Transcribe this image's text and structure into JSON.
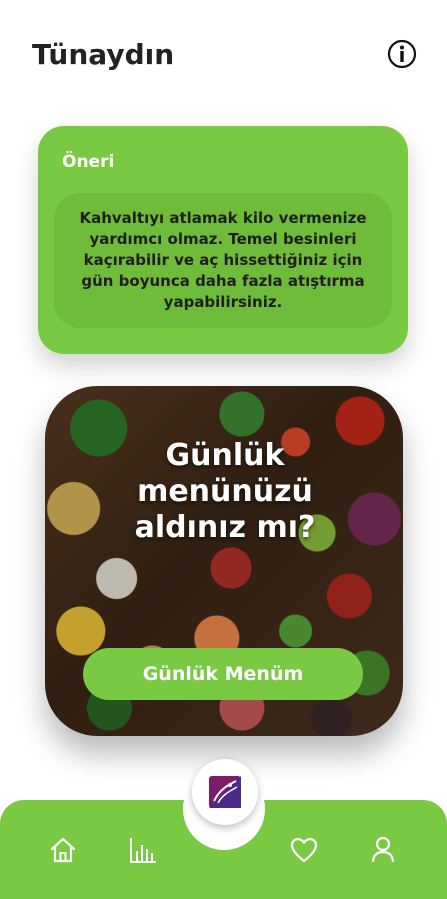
{
  "header": {
    "title": "Tünaydın",
    "info_icon": "info-icon"
  },
  "tip": {
    "title": "Öneri",
    "text": "Kahvaltıyı atlamak kilo vermenize yardımcı olmaz. Temel besinleri kaçırabilir ve aç hissettiğiniz için gün boyunca daha fazla atıştırma yapabilirsiniz."
  },
  "menu_card": {
    "question": "Günlük menünüzü aldınız mı?",
    "button_label": "Günlük Menüm"
  },
  "bottom_nav": {
    "items": [
      {
        "icon": "home-icon"
      },
      {
        "icon": "chart-icon"
      },
      {
        "icon": "app-logo-icon"
      },
      {
        "icon": "heart-icon"
      },
      {
        "icon": "user-icon"
      }
    ]
  },
  "colors": {
    "accent": "#7ac943",
    "accent_dark": "#6fbc3a",
    "logo": "#7a1e6a"
  }
}
